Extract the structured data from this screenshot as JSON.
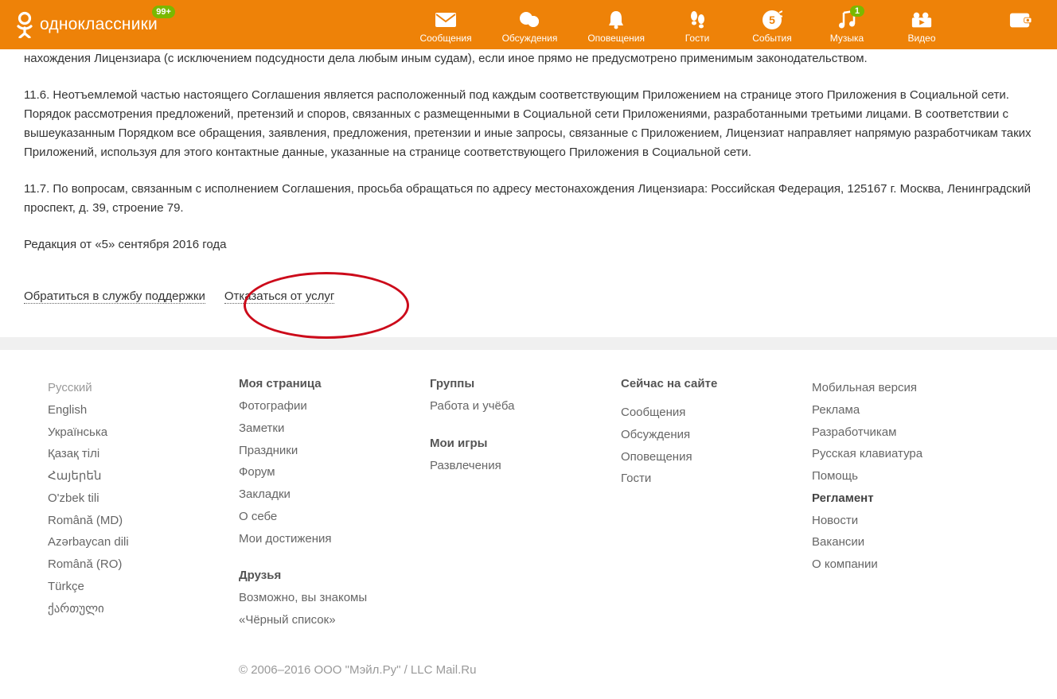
{
  "header": {
    "logo_text": "одноклассники",
    "logo_badge": "99+",
    "nav": [
      {
        "label": "Сообщения"
      },
      {
        "label": "Обсуждения"
      },
      {
        "label": "Оповещения"
      },
      {
        "label": "Гости"
      },
      {
        "label": "События"
      },
      {
        "label": "Музыка",
        "badge": "1"
      },
      {
        "label": "Видео"
      }
    ]
  },
  "content": {
    "para1": "нахождения Лицензиара (с исключением подсудности дела любым иным судам), если иное прямо не предусмотрено применимым законодательством.",
    "para2": "11.6. Неотъемлемой частью настоящего Соглашения является расположенный под каждым соответствующим Приложением на странице этого Приложения в Социальной сети. Порядок рассмотрения предложений, претензий и споров, связанных с размещенными в Социальной сети Приложениями, разработанными третьими лицами. В соответствии с вышеуказанным Порядком все обращения, заявления, предложения, претензии и иные запросы, связанные с Приложением, Лицензиат направляет напрямую разработчикам таких Приложений, используя для этого контактные данные, указанные на странице соответствующего Приложения в Социальной сети.",
    "para3": "11.7. По вопросам, связанным с исполнением Соглашения, просьба обращаться по адресу местонахождения Лицензиара: Российская Федерация, 125167 г. Москва, Ленинградский проспект, д. 39, строение 79.",
    "para4": "Редакция от «5» сентября 2016 года",
    "link_support": "Обратиться в службу поддержки",
    "link_refuse": "Отказаться от услуг"
  },
  "footer": {
    "languages": [
      "Русский",
      "English",
      "Українська",
      "Қазақ тілі",
      "Հայերեն",
      "O'zbek tili",
      "Română (MD)",
      "Azərbaycan dili",
      "Română (RO)",
      "Türkçe",
      "ქართული"
    ],
    "col_my_title": "Моя страница",
    "col_my_items": [
      "Фотографии",
      "Заметки",
      "Праздники",
      "Форум",
      "Закладки",
      "О себе",
      "Мои достижения"
    ],
    "col_friends_title": "Друзья",
    "col_friends_items": [
      "Возможно, вы знакомы",
      "«Чёрный список»"
    ],
    "col_groups_title": "Группы",
    "col_groups_items": [
      "Работа и учёба"
    ],
    "col_games_title": "Мои игры",
    "col_games_items": [
      "Развлечения"
    ],
    "col_now_title": "Сейчас на сайте",
    "col_now_items": [
      "Сообщения",
      "Обсуждения",
      "Оповещения",
      "Гости"
    ],
    "col_misc_items": [
      "Мобильная версия",
      "Реклама",
      "Разработчикам",
      "Русская клавиатура",
      "Помощь",
      "Регламент",
      "Новости",
      "Вакансии",
      "О компании"
    ],
    "copyright": "© 2006–2016 ООО \"Мэйл.Ру\" / LLC Mail.Ru"
  }
}
